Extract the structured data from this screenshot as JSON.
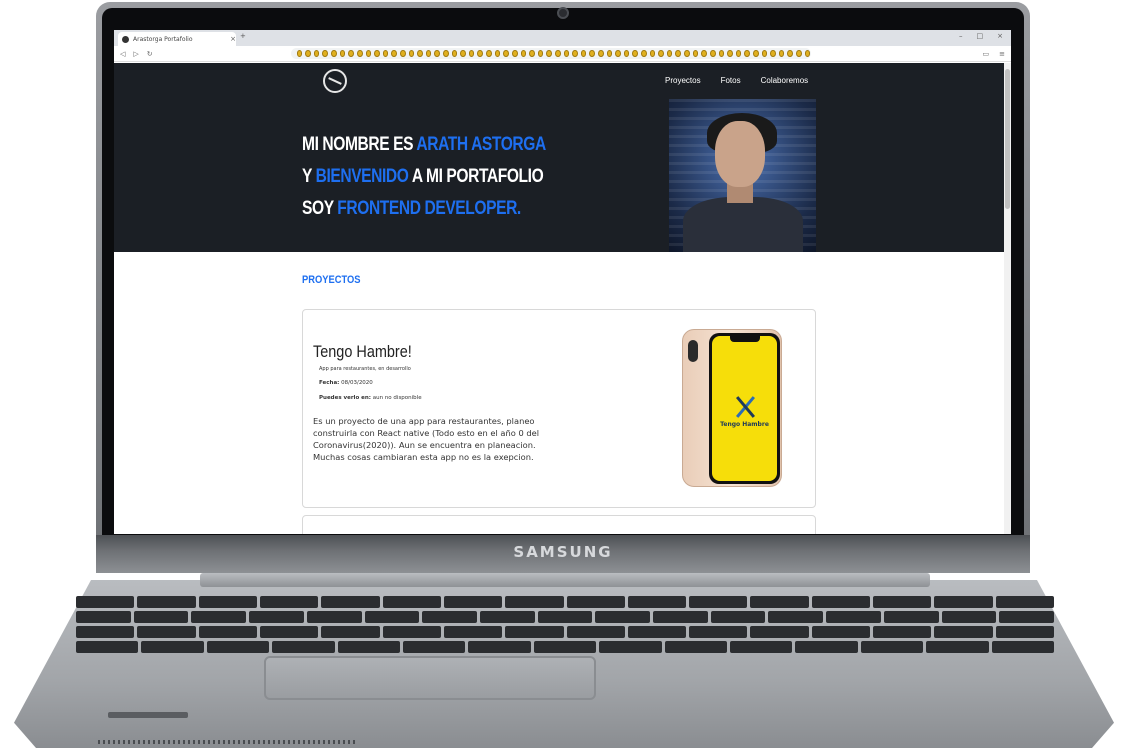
{
  "device": {
    "brand": "SAMSUNG"
  },
  "browser": {
    "tab_title": "Arastorga Portafolio",
    "tab_close": "×",
    "new_tab": "+",
    "window_controls": [
      "–",
      "□",
      "×"
    ]
  },
  "site": {
    "nav": [
      "Proyectos",
      "Fotos",
      "Colaboremos"
    ],
    "hero": {
      "line1_plain": "MI NOMBRE ES ",
      "line1_accent": "ARATH ASTORGA",
      "line2_plain_a": "Y ",
      "line2_accent": "BIENVENIDO",
      "line2_plain_b": " A MI PORTAFOLIO",
      "line3_plain": "SOY ",
      "line3_accent": "FRONTEND DEVELOPER."
    },
    "section_title": "PROYECTOS",
    "project": {
      "title": "Tengo Hambre!",
      "subtitle": "App para restaurantes, en desarrollo",
      "date_label": "Fecha:",
      "date_value": "08/03/2020",
      "view_label": "Puedes verlo en:",
      "view_value": "aun no disponible",
      "description": "Es un proyecto de una app para restaurantes, planeo construirla con React native (Todo esto en el año 0 del Coronavirus(2020)). Aun se encuentra en planeacion. Muchas cosas cambiaran esta app no es la exepcion.",
      "app_name": "Tengo Hambre"
    }
  },
  "colors": {
    "accent": "#1e6ff0",
    "hero_bg": "#1b1f25",
    "app_yellow": "#f6de0a"
  }
}
